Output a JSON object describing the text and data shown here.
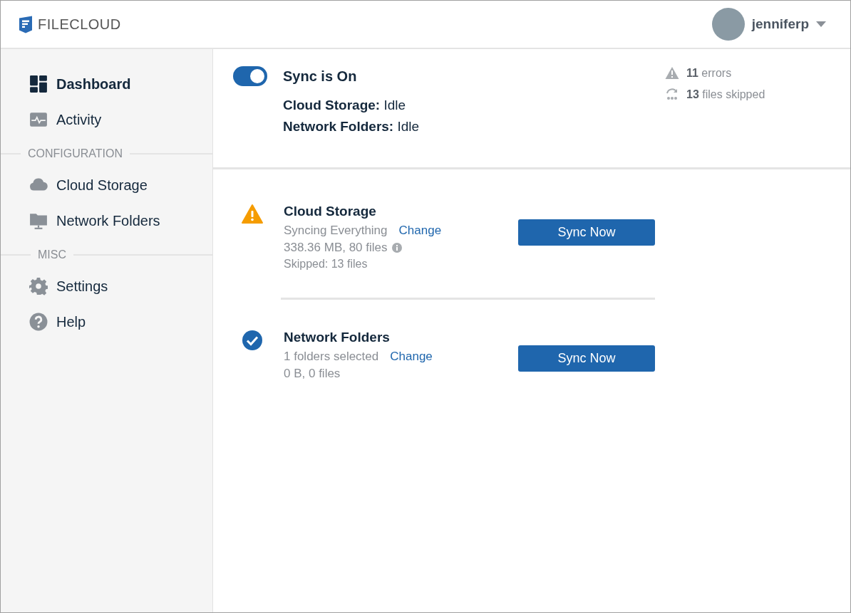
{
  "header": {
    "logo_text": "FILECLOUD",
    "user": {
      "name": "jenniferp"
    }
  },
  "sidebar": {
    "sections": [
      {
        "items": [
          {
            "label": "Dashboard",
            "kind": "dashboard",
            "selected": true
          },
          {
            "label": "Activity",
            "kind": "activity",
            "selected": false
          }
        ]
      },
      {
        "heading": "CONFIGURATION",
        "items": [
          {
            "label": "Cloud Storage",
            "kind": "cloud",
            "selected": false
          },
          {
            "label": "Network Folders",
            "kind": "folder",
            "selected": false
          }
        ]
      },
      {
        "heading": "MISC",
        "items": [
          {
            "label": "Settings",
            "kind": "gear",
            "selected": false
          },
          {
            "label": "Help",
            "kind": "help",
            "selected": false
          }
        ]
      }
    ]
  },
  "sync_summary": {
    "toggle_on": true,
    "title": "Sync is On",
    "lines": [
      {
        "label": "Cloud Storage:",
        "value": "Idle"
      },
      {
        "label": "Network Folders:",
        "value": "Idle"
      }
    ],
    "stats": [
      {
        "kind": "errors",
        "text": "**11** errors"
      },
      {
        "kind": "skipped",
        "text": "**13** files skipped"
      }
    ]
  },
  "sync_items": [
    {
      "kind": "warning",
      "title": "Cloud Storage",
      "mode": "Syncing Everything",
      "link": "Change",
      "size": "338.36 MB, 80 files",
      "info": true,
      "skipped": "Skipped: 13 files",
      "button": "Sync Now"
    },
    {
      "kind": "ok",
      "title": "Network Folders",
      "mode": "1 folders selected",
      "link": "Change",
      "size": "0 B, 0 files",
      "info": false,
      "button": "Sync Now"
    }
  ]
}
